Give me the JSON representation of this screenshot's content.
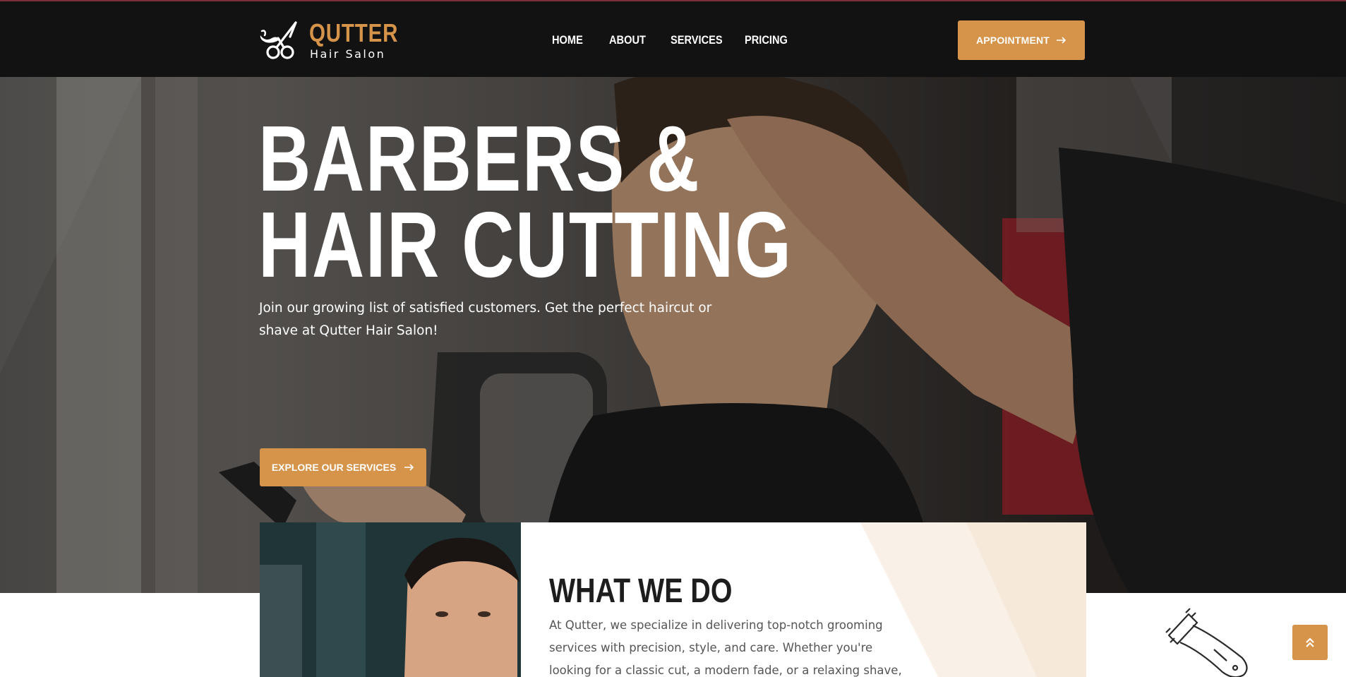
{
  "brand": {
    "name": "QUTTER",
    "tagline": "Hair Salon",
    "accent_color": "#d6944a",
    "logo_icon": "scissors-mustache-icon"
  },
  "nav": {
    "items": [
      {
        "label": "HOME"
      },
      {
        "label": "ABOUT"
      },
      {
        "label": "SERVICES"
      },
      {
        "label": "PRICING"
      }
    ],
    "cta_label": "APPOINTMENT"
  },
  "hero": {
    "title_line1": "BARBERS &",
    "title_line2": "HAIR CUTTING",
    "subtitle": "Join our growing list of satisfied customers. Get the perfect haircut or shave at Qutter Hair Salon!",
    "cta_label": "EXPLORE OUR SERVICES"
  },
  "what_we_do": {
    "title": "WHAT WE DO",
    "text": "At Qutter, we specialize in delivering top-notch grooming services with precision, style, and care. Whether you're looking for a classic cut, a modern fade, or a relaxing shave, we've got"
  },
  "scroll_top": {
    "icon": "double-chevron-up-icon"
  }
}
